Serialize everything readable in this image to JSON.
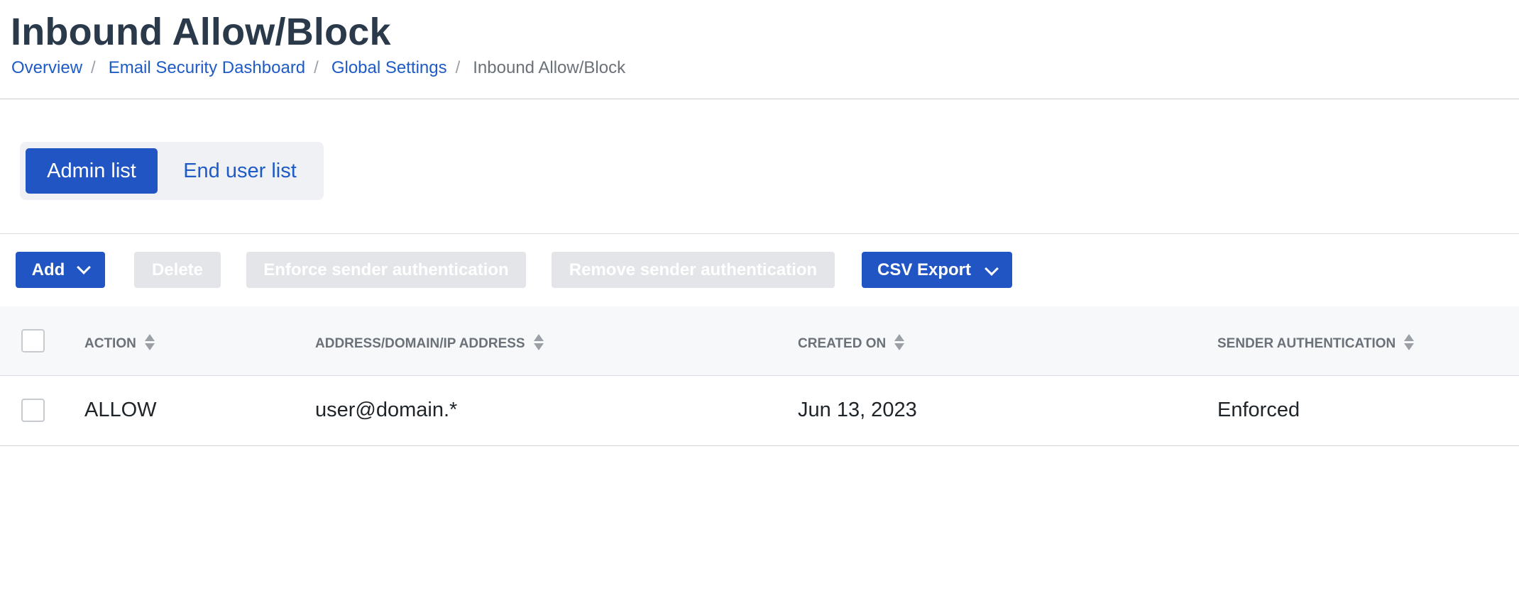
{
  "page": {
    "title": "Inbound Allow/Block"
  },
  "breadcrumb": [
    {
      "label": "Overview"
    },
    {
      "label": "Email Security Dashboard"
    },
    {
      "label": "Global Settings"
    },
    {
      "label": "Inbound Allow/Block"
    }
  ],
  "breadcrumb_separator": "/",
  "segmented": {
    "admin_label": "Admin list",
    "end_user_label": "End user list",
    "selected": "Admin list"
  },
  "toolbar": {
    "add_label": "Add",
    "delete_label": "Delete",
    "enforce_label": "Enforce sender authentication",
    "remove_label": "Remove sender authentication",
    "csv_label": "CSV Export"
  },
  "table": {
    "columns": [
      "ACTION",
      "ADDRESS/DOMAIN/IP ADDRESS",
      "CREATED ON",
      "SENDER AUTHENTICATION"
    ],
    "rows": [
      {
        "action": "ALLOW",
        "address": "user@domain.*",
        "created_on": "Jun 13, 2023",
        "sender_auth": "Enforced"
      }
    ]
  },
  "colors": {
    "primary": "#2255c4",
    "link": "#1e5bc6",
    "disabled_bg": "#e3e5e8",
    "title": "#2b3a4a"
  }
}
